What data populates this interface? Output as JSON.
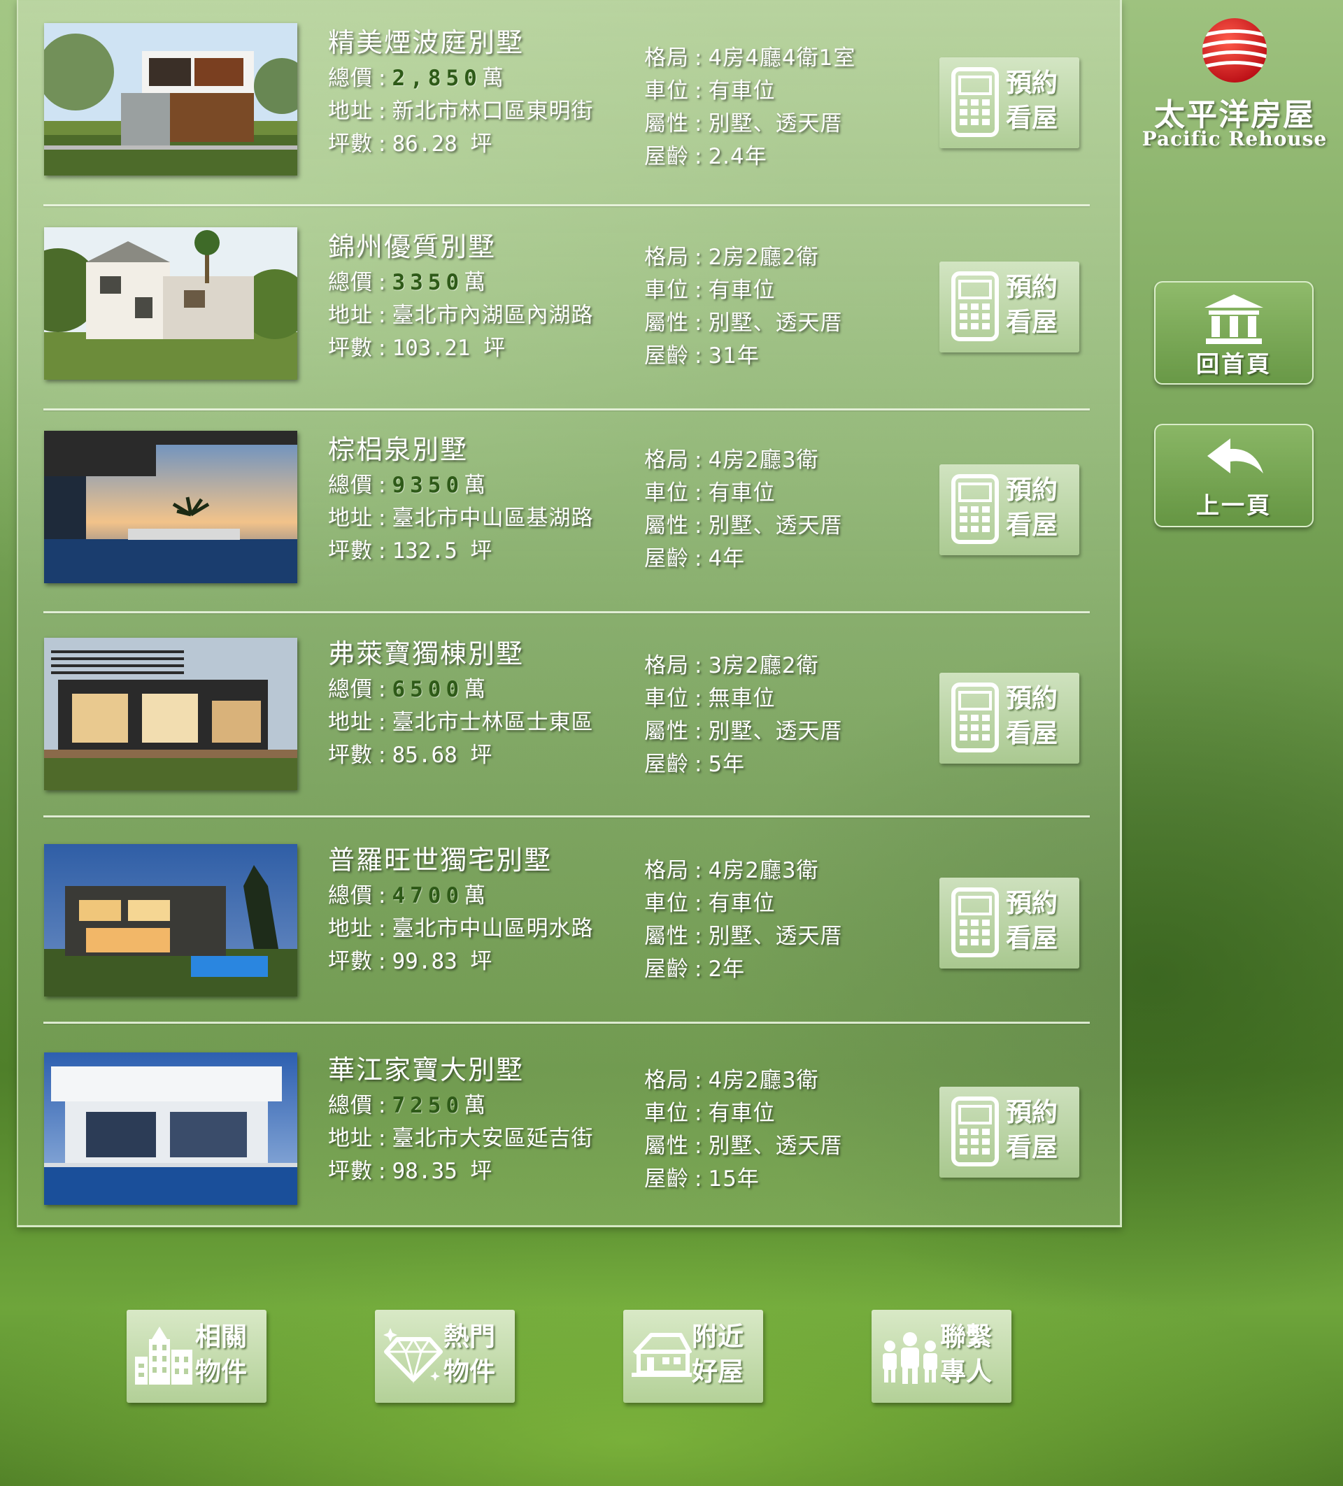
{
  "brand": {
    "name_zh": "太平洋房屋",
    "name_en": "Pacific Rehouse",
    "logo_color": "#d8141b"
  },
  "side_nav": {
    "home_label": "回首頁",
    "back_label": "上一頁"
  },
  "labels": {
    "price": "總價",
    "address": "地址",
    "area": "坪數",
    "layout": "格局",
    "parking": "車位",
    "type": "屬性",
    "age": "屋齡",
    "book_viewing": "預約看屋"
  },
  "listings": [
    {
      "title": "精美煙波庭別墅",
      "price": "2,850",
      "price_unit": "萬",
      "address": "新北市林口區東明街",
      "area": "86.28 坪",
      "layout": "4房4廳4衛1室",
      "parking": "有車位",
      "type": "別墅、透天厝",
      "age": "2.4年"
    },
    {
      "title": "錦州優質別墅",
      "price": "3350",
      "price_unit": "萬",
      "address": "臺北市內湖區內湖路",
      "area": "103.21 坪",
      "layout": "2房2廳2衛",
      "parking": "有車位",
      "type": "別墅、透天厝",
      "age": "31年"
    },
    {
      "title": "棕梠泉別墅",
      "price": "9350",
      "price_unit": "萬",
      "address": "臺北市中山區基湖路",
      "area": "132.5 坪",
      "layout": "4房2廳3衛",
      "parking": "有車位",
      "type": "別墅、透天厝",
      "age": "4年"
    },
    {
      "title": "弗萊寶獨棟別墅",
      "price": "6500",
      "price_unit": "萬",
      "address": "臺北市士林區士東區",
      "area": "85.68 坪",
      "layout": "3房2廳2衛",
      "parking": "無車位",
      "type": "別墅、透天厝",
      "age": "5年"
    },
    {
      "title": "普羅旺世獨宅別墅",
      "price": "4700",
      "price_unit": "萬",
      "address": "臺北市中山區明水路",
      "area": "99.83 坪",
      "layout": "4房2廳3衛",
      "parking": "有車位",
      "type": "別墅、透天厝",
      "age": "2年"
    },
    {
      "title": "華江家寶大別墅",
      "price": "7250",
      "price_unit": "萬",
      "address": "臺北市大安區延吉街",
      "area": "98.35 坪",
      "layout": "4房2廳3衛",
      "parking": "有車位",
      "type": "別墅、透天厝",
      "age": "15年"
    }
  ],
  "bottom_nav": [
    {
      "label": "相關物件",
      "icon": "building-icon"
    },
    {
      "label": "熱門物件",
      "icon": "diamond-icon"
    },
    {
      "label": "附近好屋",
      "icon": "house-icon"
    },
    {
      "label": "聯繫專人",
      "icon": "people-icon"
    }
  ],
  "colors": {
    "price_text": "#2e5a18",
    "background": "#5d8a3c",
    "panel_border": "#e1f0d2"
  }
}
